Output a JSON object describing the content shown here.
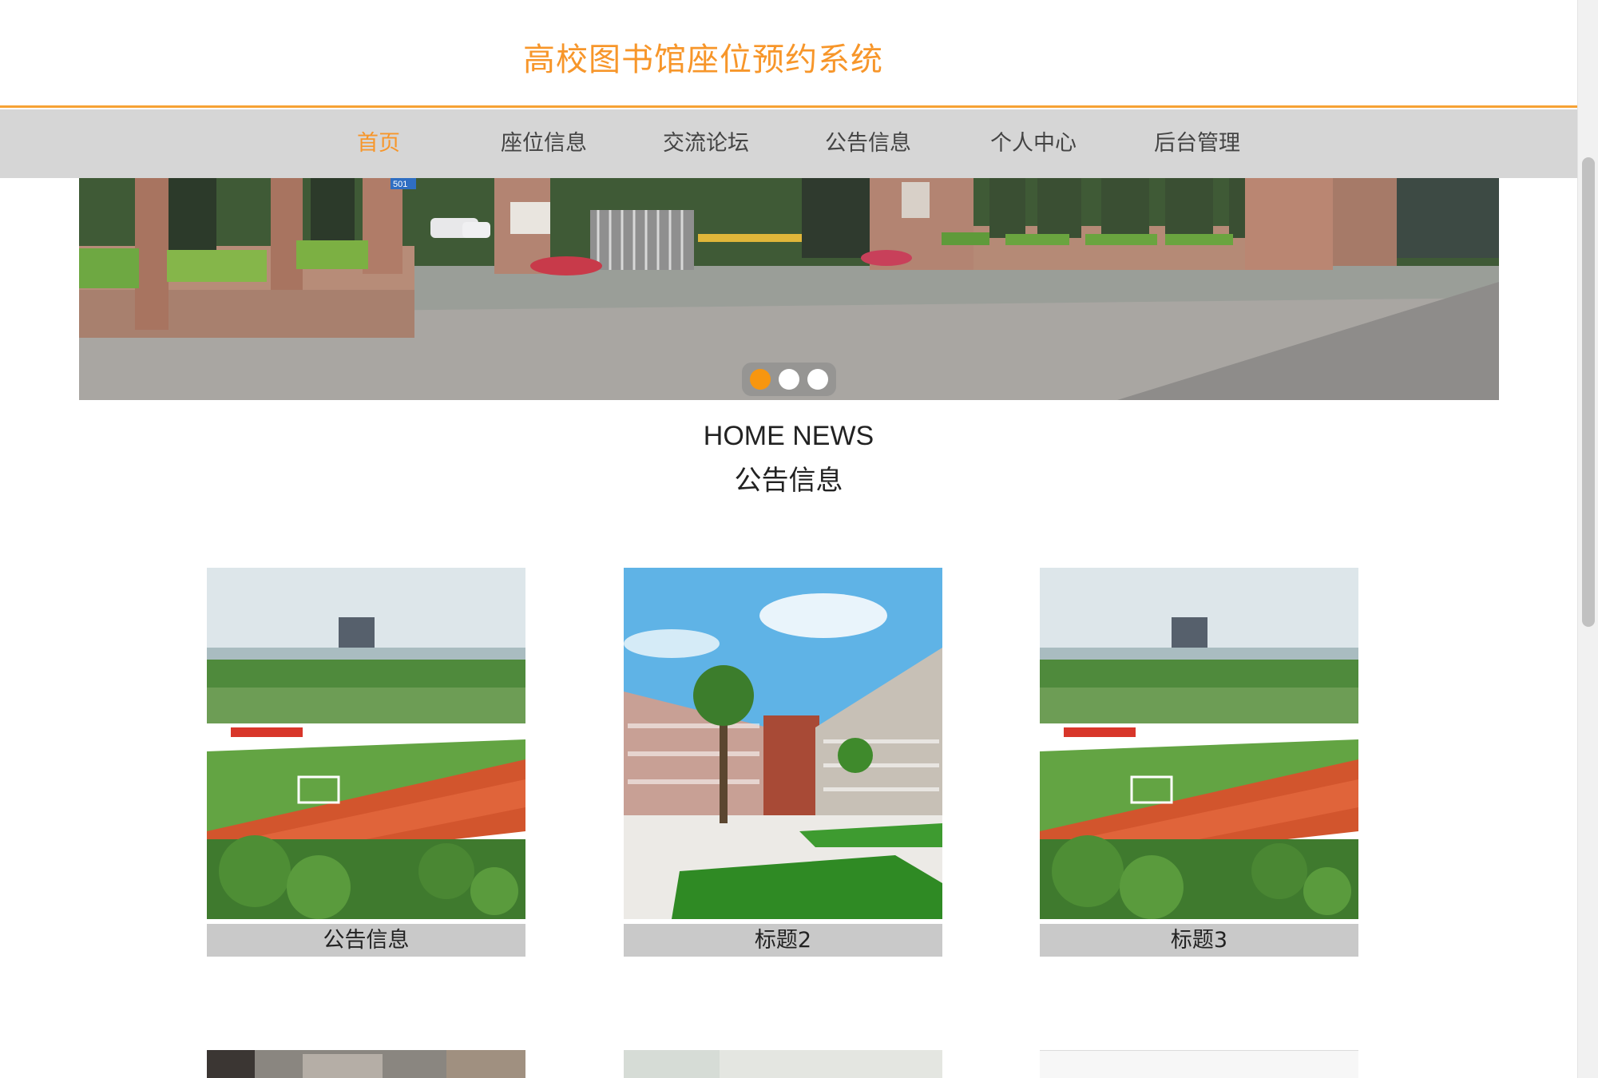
{
  "header": {
    "site_title": "高校图书馆座位预约系统"
  },
  "nav": {
    "items": [
      {
        "label": "首页",
        "active": true
      },
      {
        "label": "座位信息"
      },
      {
        "label": "交流论坛"
      },
      {
        "label": "公告信息"
      },
      {
        "label": "个人中心"
      },
      {
        "label": "后台管理"
      }
    ]
  },
  "banner": {
    "slides": 3,
    "active_slide": 0,
    "gate_number_sign": "501"
  },
  "section": {
    "title_en": "HOME NEWS",
    "title_cn": "公告信息"
  },
  "cards": [
    {
      "caption": "公告信息",
      "image": "campus-sports-field-photo"
    },
    {
      "caption": "标题2",
      "image": "campus-teaching-building-photo"
    },
    {
      "caption": "标题3",
      "image": "campus-sports-field-photo"
    },
    {
      "caption": "",
      "image": "interior-photo"
    },
    {
      "caption": "",
      "image": "light-photo"
    },
    {
      "caption": "",
      "image": "blank-photo"
    }
  ],
  "colors": {
    "accent": "#f7962a",
    "nav_bg": "#d6d6d6",
    "caption_bg": "#c9c9c9"
  }
}
